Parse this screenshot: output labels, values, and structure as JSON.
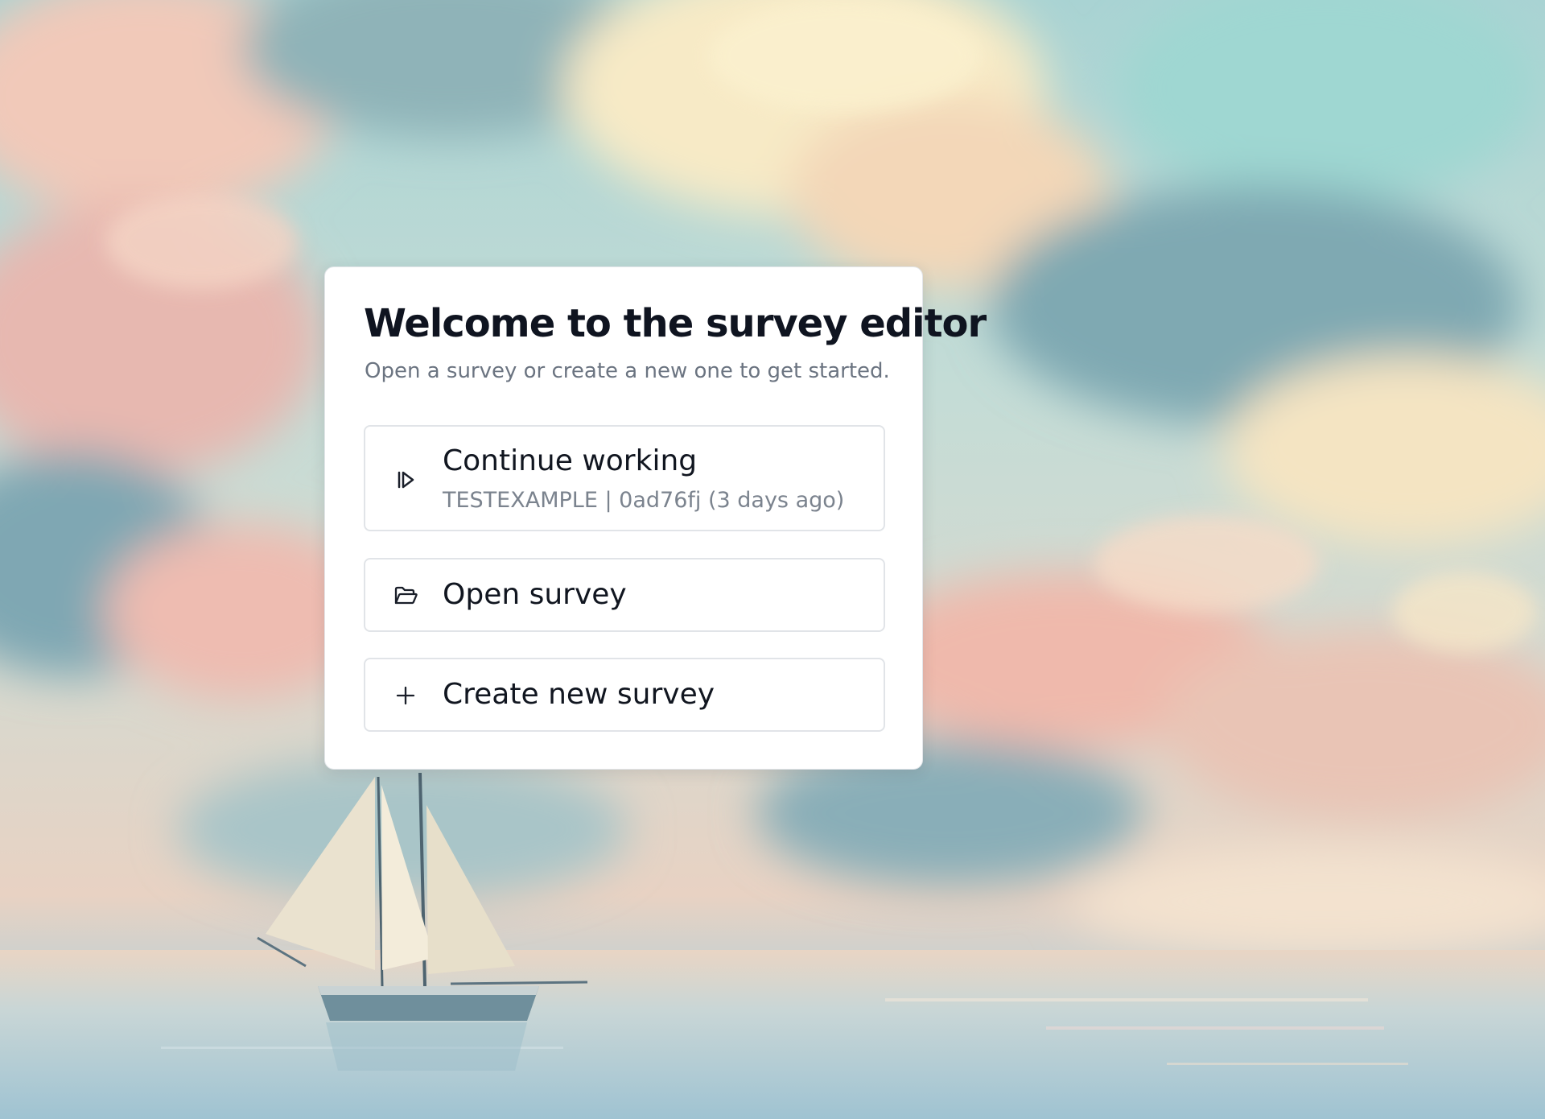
{
  "welcome": {
    "title": "Welcome to the survey editor",
    "subtitle": "Open a survey or create a new one to get started."
  },
  "actions": [
    {
      "label": "Continue working",
      "meta": "TESTEXAMPLE | 0ad76fj (3 days ago)",
      "icon": "resume-play-icon"
    },
    {
      "label": "Open survey",
      "icon": "folder-open-icon"
    },
    {
      "label": "Create new survey",
      "icon": "plus-icon"
    }
  ],
  "background": {
    "subject": "sailing ship on calm sea under pastel clouds",
    "colors": [
      "#a9d3d3",
      "#f2c8b8",
      "#f6e8c0",
      "#7fa7b3",
      "#e6b9b0"
    ]
  }
}
